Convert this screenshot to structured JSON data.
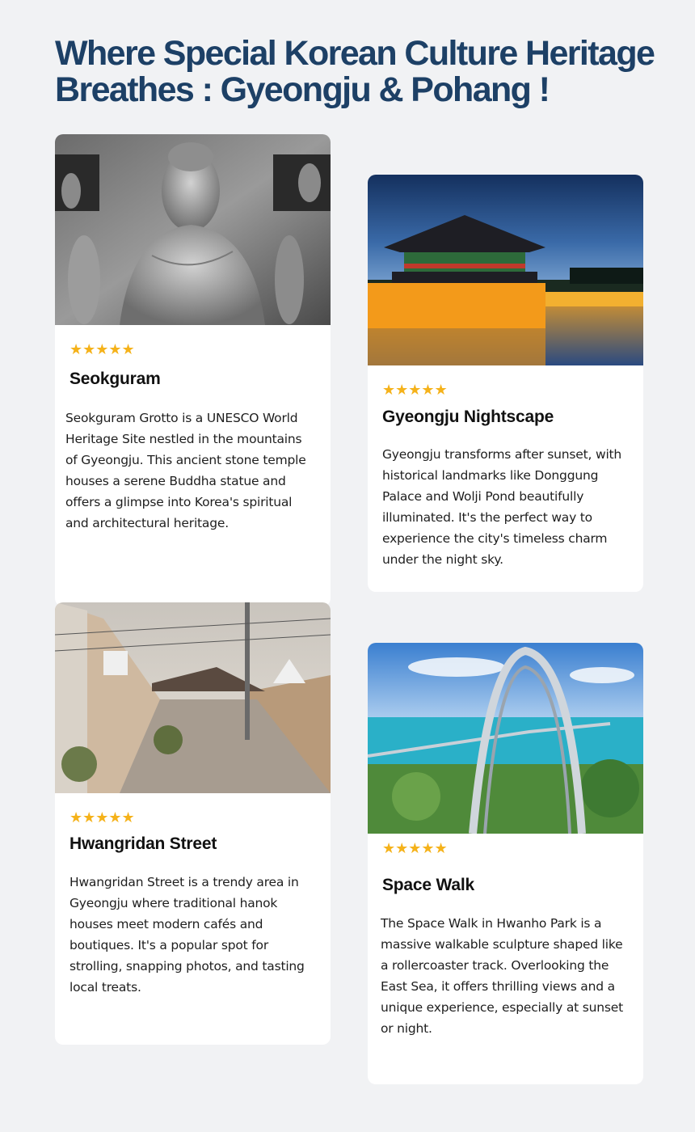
{
  "page": {
    "title_line1": "Where Special Korean Culture Heritage",
    "title_line2": "Breathes : Gyeongju & Pohang !"
  },
  "colors": {
    "title": "#1d4066",
    "star": "#f5b21a",
    "background": "#f1f2f4",
    "card": "#ffffff"
  },
  "cards": [
    {
      "image": "seokguram-buddha-photo",
      "rating": "★★★★★",
      "title": "Seokguram",
      "description": "Seokguram Grotto is a UNESCO World Heritage Site nestled in the mountains of Gyeongju. This ancient stone temple houses a serene Buddha statue and offers a glimpse into Korea's spiritual and architectural heritage."
    },
    {
      "image": "gyeongju-night-pavilion-photo",
      "rating": "★★★★★",
      "title": "Gyeongju Nightscape",
      "description": "Gyeongju transforms after sunset, with historical landmarks like Donggung Palace and Wolji Pond beautifully illuminated. It's the perfect way to experience the city's timeless charm under the night sky."
    },
    {
      "image": "hwangridan-street-photo",
      "rating": "★★★★★",
      "title": "Hwangridan Street",
      "description": "Hwangridan Street is a trendy area in Gyeongju where traditional hanok houses meet modern cafés and boutiques. It's a popular spot for strolling, snapping photos, and tasting local treats."
    },
    {
      "image": "space-walk-sculpture-photo",
      "rating": "★★★★★",
      "title": "Space Walk",
      "description": "The Space Walk in Hwanho Park is a massive walkable sculpture shaped like a rollercoaster track. Overlooking the East Sea, it offers thrilling views and a unique experience, especially at sunset or night."
    }
  ]
}
